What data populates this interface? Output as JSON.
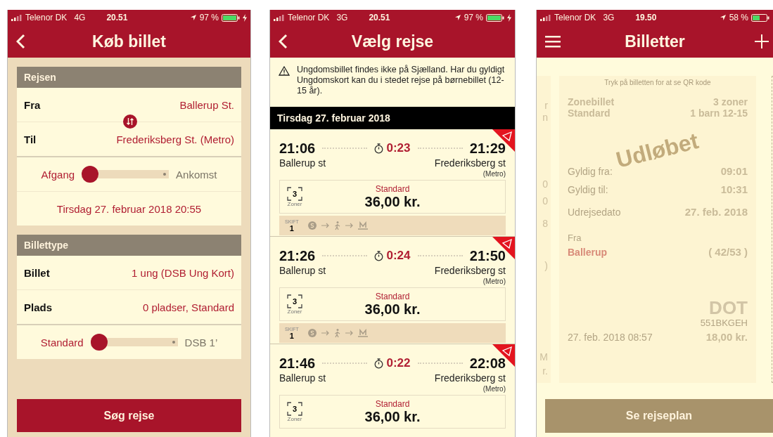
{
  "buy_ticket": {
    "status_bar": {
      "carrier": "Telenor DK",
      "network": "4G",
      "time": "20.51",
      "battery": "97 %",
      "charging": true
    },
    "header": {
      "actions": [
        {
          "kind": "back"
        }
      ],
      "title": "Køb billet"
    },
    "journey_section": {
      "title": "Rejsen",
      "from_label": "Fra",
      "from_value": "Ballerup St.",
      "to_label": "Til",
      "to_value": "Frederiksberg St. (Metro)",
      "toggle": {
        "left": "Afgang",
        "right": "Ankomst",
        "level": 0
      },
      "datetime": "Tirsdag 27. februar 2018 20:55"
    },
    "ticket_type_section": {
      "title": "Billettype",
      "rows": [
        {
          "label": "Billet",
          "value": "1 ung (DSB Ung Kort)"
        },
        {
          "label": "Plads",
          "value": "0 pladser, Standard"
        }
      ],
      "toggle": {
        "left": "Standard",
        "right": "DSB 1’",
        "level": 0
      }
    },
    "search_button": "Søg rejse"
  },
  "choose_journey": {
    "status_bar": {
      "carrier": "Telenor DK",
      "network": "3G",
      "time": "20.51",
      "battery": "97 %",
      "charging": true
    },
    "header": {
      "actions": [
        {
          "kind": "back"
        }
      ],
      "title": "Vælg rejse"
    },
    "notice": "Ungdomsbillet findes ikke på Sjælland. Har du gyldigt Ungdomskort kan du i stedet rejse på børnebillet (12-15 år).",
    "date": "Tirsdag 27. februar 2018",
    "journeys": [
      {
        "departure": "21:06",
        "duration": "0:23",
        "arrival": "21:29",
        "from": "Ballerup st",
        "to": "Frederiksberg st",
        "to_note": "(Metro)",
        "zones": "3",
        "zones_label": "Zoner",
        "fare_class": "Standard",
        "price": "36,00 kr.",
        "changes_label": "SKIFT",
        "changes": "1"
      },
      {
        "departure": "21:26",
        "duration": "0:24",
        "arrival": "21:50",
        "from": "Ballerup st",
        "to": "Frederiksberg st",
        "to_note": "(Metro)",
        "zones": "3",
        "zones_label": "Zoner",
        "fare_class": "Standard",
        "price": "36,00 kr.",
        "changes_label": "SKIFT",
        "changes": "1"
      },
      {
        "departure": "21:46",
        "duration": "0:22",
        "arrival": "22:08",
        "from": "Ballerup st",
        "to": "Frederiksberg st",
        "to_note": "(Metro)",
        "zones": "3",
        "zones_label": "Zoner",
        "fare_class": "Standard",
        "price": "36,00 kr."
      }
    ]
  },
  "tickets": {
    "status_bar": {
      "carrier": "Telenor DK",
      "network": "3G",
      "time": "19.50",
      "battery": "58 %",
      "charging": false
    },
    "header": {
      "actions": [
        {
          "kind": "menu"
        },
        {
          "kind": "add"
        }
      ],
      "title": "Billetter"
    },
    "prev_ticket_fragments": [
      "r",
      "n",
      "0",
      "0",
      "8",
      ")",
      "M",
      "r."
    ],
    "ticket": {
      "hint": "Tryk på billetten for at se QR kode",
      "type": "Zonebillet",
      "zones": "3 zoner",
      "class": "Standard",
      "passengers": "1 barn 12-15",
      "valid_from_label": "Gyldig fra:",
      "valid_from": "09:01",
      "valid_to_label": "Gyldig til:",
      "valid_to": "10:31",
      "date_label": "Udrejsedato",
      "date": "27. feb. 2018",
      "from_label": "Fra",
      "from": "Ballerup",
      "zone_range": "( 42/53 )",
      "logo": "DOT",
      "code": "551BKGEH",
      "purchased": "27. feb. 2018 08:57",
      "price": "18,00 kr.",
      "stamp": "Udløbet"
    },
    "button": "Se rejseplan"
  }
}
